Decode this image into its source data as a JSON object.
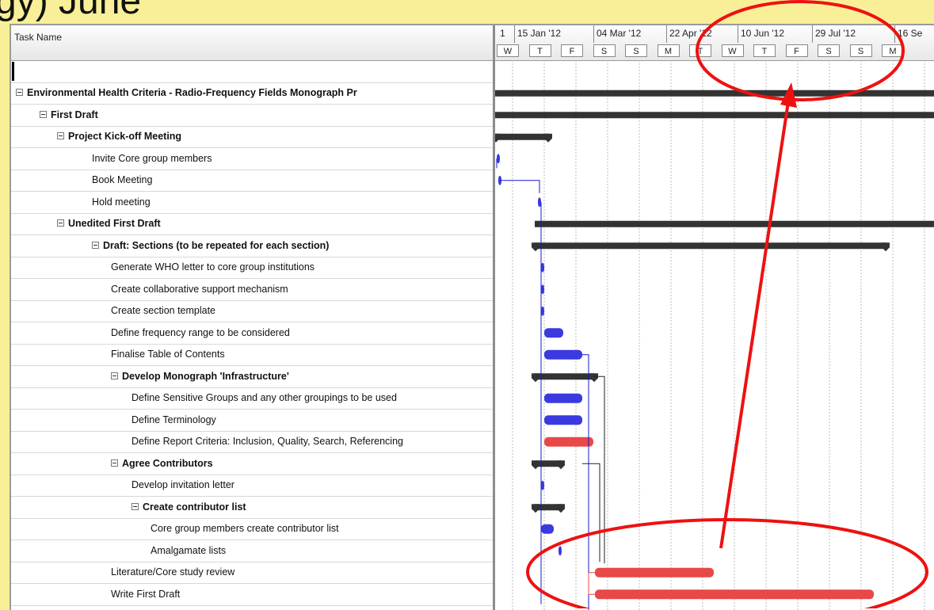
{
  "slide": {
    "title_fragment": "gy) June"
  },
  "table": {
    "header": "Task Name"
  },
  "tasks": [
    {
      "name": "Environmental Health Criteria - Radio-Frequency Fields Monograph Pr",
      "level": 0,
      "summary": true
    },
    {
      "name": "First Draft",
      "level": 1,
      "summary": true
    },
    {
      "name": "Project Kick-off Meeting",
      "level": 2,
      "summary": true
    },
    {
      "name": "Invite Core group members",
      "level": 3,
      "summary": false
    },
    {
      "name": "Book Meeting",
      "level": 3,
      "summary": false
    },
    {
      "name": "Hold meeting",
      "level": 3,
      "summary": false
    },
    {
      "name": "Unedited First Draft",
      "level": 2,
      "summary": true
    },
    {
      "name": "Draft: Sections (to be repeated for each section)",
      "level": 3,
      "summary": true
    },
    {
      "name": "Generate WHO letter to core group institutions",
      "level": 4,
      "summary": false
    },
    {
      "name": "Create collaborative support mechanism",
      "level": 4,
      "summary": false
    },
    {
      "name": "Create section template",
      "level": 4,
      "summary": false
    },
    {
      "name": "Define frequency range to be considered",
      "level": 4,
      "summary": false
    },
    {
      "name": "Finalise Table of Contents",
      "level": 4,
      "summary": false
    },
    {
      "name": "Develop Monograph 'Infrastructure'",
      "level": 4,
      "summary": true
    },
    {
      "name": "Define Sensitive Groups and any other groupings to be used",
      "level": 5,
      "summary": false
    },
    {
      "name": "Define Terminology",
      "level": 5,
      "summary": false
    },
    {
      "name": "Define Report Criteria:  Inclusion, Quality, Search, Referencing",
      "level": 5,
      "summary": false
    },
    {
      "name": "Agree Contributors",
      "level": 4,
      "summary": true
    },
    {
      "name": "Develop invitation letter",
      "level": 5,
      "summary": false
    },
    {
      "name": "Create contributor list",
      "level": 5,
      "summary": true
    },
    {
      "name": "Core group members create contributor list",
      "level": 6,
      "summary": false
    },
    {
      "name": "Amalgamate lists",
      "level": 6,
      "summary": false
    },
    {
      "name": "Literature/Core study review",
      "level": 4,
      "summary": false
    },
    {
      "name": "Write First Draft",
      "level": 4,
      "summary": false
    }
  ],
  "timescale": {
    "top": [
      "1",
      "15 Jan '12",
      "04 Mar '12",
      "22 Apr '12",
      "10 Jun '12",
      "29 Jul '12",
      "16 Se"
    ],
    "bottom": [
      "W",
      "T",
      "F",
      "S",
      "S",
      "M",
      "T",
      "W",
      "T",
      "F",
      "S",
      "S",
      "M"
    ]
  },
  "colors": {
    "slide_bg": "#f9ef98",
    "summary_bar": "#333333",
    "task_bar": "#3a3ae0",
    "critical_bar": "#e84848",
    "link": "#1a1acc",
    "annotation": "#ee1111"
  }
}
